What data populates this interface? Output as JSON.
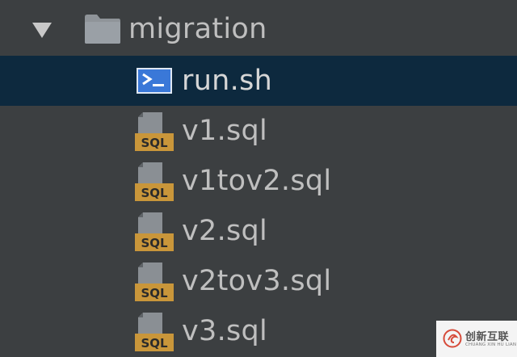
{
  "tree": {
    "folder": {
      "name": "migration",
      "expanded": true,
      "icon": "folder-icon"
    },
    "files": [
      {
        "name": "run.sh",
        "icon": "shell-script-icon",
        "icon_text": ">_",
        "selected": true
      },
      {
        "name": "v1.sql",
        "icon": "sql-file-icon",
        "icon_text": "SQL",
        "selected": false
      },
      {
        "name": "v1tov2.sql",
        "icon": "sql-file-icon",
        "icon_text": "SQL",
        "selected": false
      },
      {
        "name": "v2.sql",
        "icon": "sql-file-icon",
        "icon_text": "SQL",
        "selected": false
      },
      {
        "name": "v2tov3.sql",
        "icon": "sql-file-icon",
        "icon_text": "SQL",
        "selected": false
      },
      {
        "name": "v3.sql",
        "icon": "sql-file-icon",
        "icon_text": "SQL",
        "selected": false
      }
    ]
  },
  "colors": {
    "background": "#3c3f41",
    "selection": "#0d293e",
    "text": "#bfbfbf",
    "sql_badge": "#c9963a",
    "shell_icon": "#3d7ad9"
  },
  "watermark": {
    "text": "创新互联",
    "subtext": "CHUANG XIN HU LIAN"
  }
}
